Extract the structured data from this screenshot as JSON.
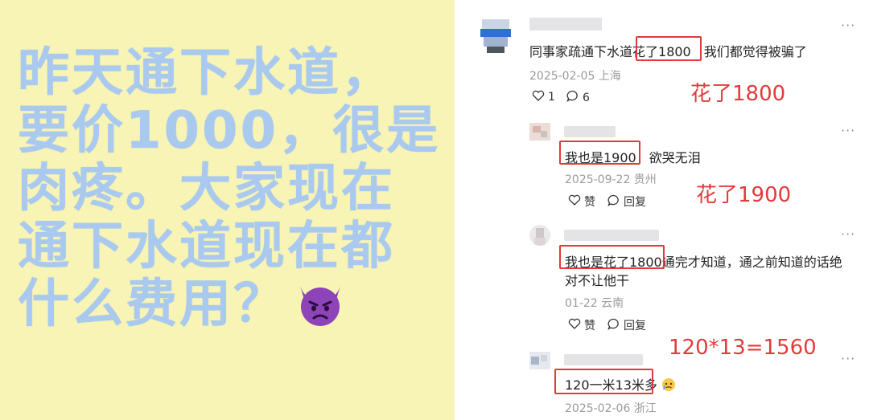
{
  "left": {
    "lines": [
      "昨天通下水道，",
      "要价1000，很是",
      "肉疼。大家现在",
      "通下水道现在都",
      "什么费用？"
    ],
    "emoji": "devil-face-icon"
  },
  "comments": [
    {
      "text": "同事家疏通下水道花了1800  我们都觉得被骗了",
      "text_before": "同事家疏通下水道",
      "highlight": "花了1800",
      "text_after": "我们都觉得被骗了",
      "meta": "2025-02-05 上海",
      "like_count": "1",
      "reply_count": "6",
      "note": "花了1800"
    },
    {
      "highlight": "我也是1900",
      "text_after": "欲哭无泪",
      "meta": "2025-09-22 贵州",
      "like_label": "赞",
      "reply_label": "回复",
      "note": "花了1900"
    },
    {
      "highlight": "我也是花了1800",
      "text_after": "通完才知道，通之前知道的话绝",
      "text_line2": "对不让他干",
      "meta": "01-22 云南",
      "like_label": "赞",
      "reply_label": "回复"
    },
    {
      "highlight": "120一米13米多",
      "meta": "2025-02-06 浙江",
      "note": "120*13=1560"
    }
  ],
  "more_label": "···",
  "colors": {
    "panel_yellow": "#f8f4b6",
    "big_text_blue": "#a9c9ef",
    "annotation_red": "#e23a3a"
  }
}
